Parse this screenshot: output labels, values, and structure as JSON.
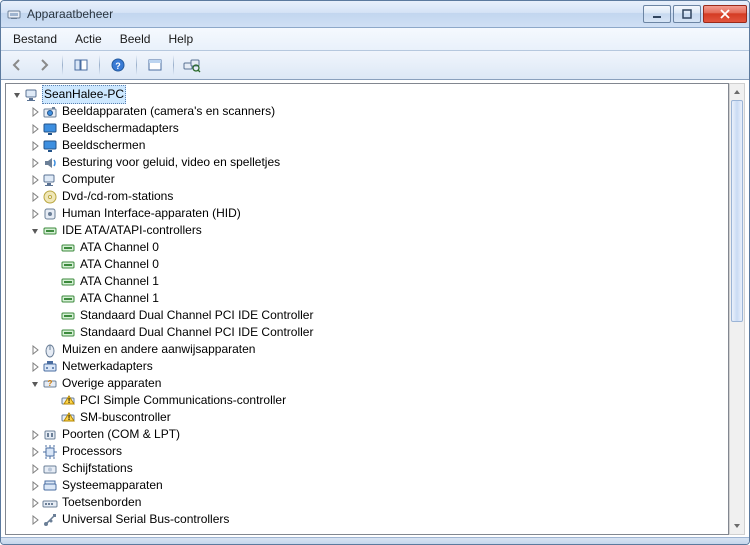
{
  "window_title": "Apparaatbeheer",
  "menubar": {
    "items": [
      "Bestand",
      "Actie",
      "Beeld",
      "Help"
    ]
  },
  "toolbar": {
    "buttons": [
      {
        "name": "back-icon"
      },
      {
        "name": "forward-icon"
      },
      {
        "name": "show-hide-tree-icon"
      },
      {
        "name": "help-icon"
      },
      {
        "name": "properties-icon"
      },
      {
        "name": "scan-hardware-icon"
      }
    ]
  },
  "root_label": "SeanHalee-PC",
  "tree": [
    {
      "icon": "camera",
      "label": "Beeldapparaten (camera's en scanners)",
      "exp": "closed",
      "depth": 1
    },
    {
      "icon": "display",
      "label": "Beeldschermadapters",
      "exp": "closed",
      "depth": 1
    },
    {
      "icon": "monitor",
      "label": "Beeldschermen",
      "exp": "closed",
      "depth": 1
    },
    {
      "icon": "sound",
      "label": "Besturing voor geluid, video en spelletjes",
      "exp": "closed",
      "depth": 1
    },
    {
      "icon": "computer",
      "label": "Computer",
      "exp": "closed",
      "depth": 1
    },
    {
      "icon": "dvd",
      "label": "Dvd-/cd-rom-stations",
      "exp": "closed",
      "depth": 1
    },
    {
      "icon": "hid",
      "label": "Human Interface-apparaten (HID)",
      "exp": "closed",
      "depth": 1
    },
    {
      "icon": "ide",
      "label": "IDE ATA/ATAPI-controllers",
      "exp": "open",
      "depth": 1
    },
    {
      "icon": "ide",
      "label": "ATA Channel 0",
      "exp": "none",
      "depth": 2
    },
    {
      "icon": "ide",
      "label": "ATA Channel 0",
      "exp": "none",
      "depth": 2
    },
    {
      "icon": "ide",
      "label": "ATA Channel 1",
      "exp": "none",
      "depth": 2
    },
    {
      "icon": "ide",
      "label": "ATA Channel 1",
      "exp": "none",
      "depth": 2
    },
    {
      "icon": "ide",
      "label": "Standaard Dual Channel PCI IDE Controller",
      "exp": "none",
      "depth": 2
    },
    {
      "icon": "ide",
      "label": "Standaard Dual Channel PCI IDE Controller",
      "exp": "none",
      "depth": 2
    },
    {
      "icon": "mouse",
      "label": "Muizen en andere aanwijsapparaten",
      "exp": "closed",
      "depth": 1
    },
    {
      "icon": "network",
      "label": "Netwerkadapters",
      "exp": "closed",
      "depth": 1
    },
    {
      "icon": "other",
      "label": "Overige apparaten",
      "exp": "open",
      "depth": 1
    },
    {
      "icon": "warn",
      "label": "PCI Simple Communications-controller",
      "exp": "none",
      "depth": 2
    },
    {
      "icon": "warn",
      "label": "SM-buscontroller",
      "exp": "none",
      "depth": 2
    },
    {
      "icon": "port",
      "label": "Poorten (COM & LPT)",
      "exp": "closed",
      "depth": 1
    },
    {
      "icon": "cpu",
      "label": "Processors",
      "exp": "closed",
      "depth": 1
    },
    {
      "icon": "disk",
      "label": "Schijfstations",
      "exp": "closed",
      "depth": 1
    },
    {
      "icon": "system",
      "label": "Systeemapparaten",
      "exp": "closed",
      "depth": 1
    },
    {
      "icon": "keyboard",
      "label": "Toetsenborden",
      "exp": "closed",
      "depth": 1
    },
    {
      "icon": "usb",
      "label": "Universal Serial Bus-controllers",
      "exp": "closed",
      "depth": 1
    }
  ]
}
